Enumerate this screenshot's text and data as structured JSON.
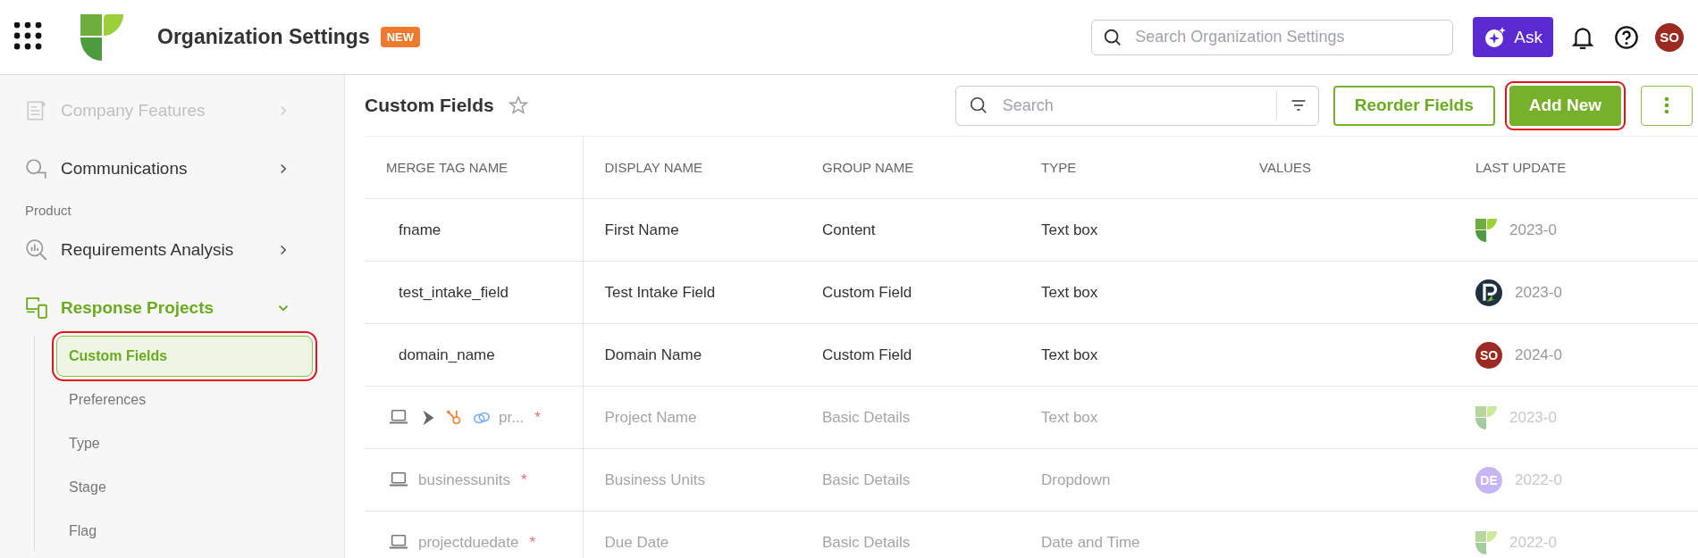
{
  "topbar": {
    "title": "Organization Settings",
    "badge": "NEW",
    "search": {
      "placeholder": "Search Organization Settings"
    },
    "ask_button": "Ask",
    "avatar": {
      "initials": "SO",
      "color": "#9b2a22"
    }
  },
  "sidebar": {
    "items": [
      {
        "kind": "link",
        "label": "Company Features",
        "dimmed": true
      },
      {
        "kind": "link",
        "label": "Communications",
        "dimmed": false
      },
      {
        "kind": "section",
        "label": "Product"
      },
      {
        "kind": "link",
        "label": "Requirements Analysis",
        "dimmed": false
      },
      {
        "kind": "group",
        "label": "Response Projects",
        "selected": true,
        "expanded": true,
        "children": [
          {
            "label": "Custom Fields",
            "selected": true,
            "highlighted": true
          },
          {
            "label": "Preferences",
            "selected": false,
            "highlighted": false
          },
          {
            "label": "Type",
            "selected": false,
            "highlighted": false
          },
          {
            "label": "Stage",
            "selected": false,
            "highlighted": false
          },
          {
            "label": "Flag",
            "selected": false,
            "highlighted": false
          }
        ]
      }
    ]
  },
  "page": {
    "title": "Custom Fields",
    "starred": false,
    "search": {
      "placeholder": "Search"
    },
    "buttons": [
      {
        "kind": "outline",
        "label": "Reorder Fields",
        "highlighted": false
      },
      {
        "kind": "primary",
        "label": "Add New",
        "highlighted": true
      },
      {
        "kind": "more",
        "highlighted": false
      }
    ]
  },
  "table": {
    "columns": [
      "MERGE TAG NAME",
      "DISPLAY NAME",
      "GROUP NAME",
      "TYPE",
      "VALUES",
      "LAST UPDATE"
    ],
    "rows": [
      {
        "merge_tag": "fname",
        "sources": [],
        "display_name": "First Name",
        "group_name": "Content",
        "type": "Text box",
        "disabled": false,
        "updater": {
          "kind": "logo"
        },
        "last_updated": "2023-0"
      },
      {
        "merge_tag": "test_intake_field",
        "sources": [],
        "display_name": "Test Intake Field",
        "group_name": "Custom Field",
        "type": "Text box",
        "disabled": false,
        "updater": {
          "kind": "r-logo"
        },
        "last_updated": "2023-0"
      },
      {
        "merge_tag": "domain_name",
        "sources": [],
        "display_name": "Domain Name",
        "group_name": "Custom Field",
        "type": "Text box",
        "disabled": false,
        "updater": {
          "kind": "initials",
          "initials": "SO",
          "color": "#9b2a22"
        },
        "last_updated": "2024-0"
      },
      {
        "merge_tag": "pr...",
        "required_mark": "*",
        "sources": [
          {
            "kind": "laptop"
          },
          {
            "kind": "play"
          },
          {
            "kind": "hub"
          },
          {
            "kind": "link"
          }
        ],
        "display_name": "Project Name",
        "group_name": "Basic Details",
        "type": "Text box",
        "disabled": true,
        "updater": {
          "kind": "logo"
        },
        "last_updated": "2023-0"
      },
      {
        "merge_tag": "businessunits",
        "required_mark": "*",
        "sources": [
          {
            "kind": "laptop"
          }
        ],
        "display_name": "Business Units",
        "group_name": "Basic Details",
        "type": "Dropdown",
        "disabled": true,
        "updater": {
          "kind": "initials",
          "initials": "DE",
          "color": "#c6b6f6"
        },
        "last_updated": "2022-0"
      },
      {
        "merge_tag": "projectduedate",
        "required_mark": "*",
        "sources": [
          {
            "kind": "laptop"
          }
        ],
        "display_name": "Due Date",
        "group_name": "Basic Details",
        "type": "Date and Time",
        "disabled": true,
        "updater": {
          "kind": "logo"
        },
        "last_updated": "2022-0"
      }
    ]
  }
}
